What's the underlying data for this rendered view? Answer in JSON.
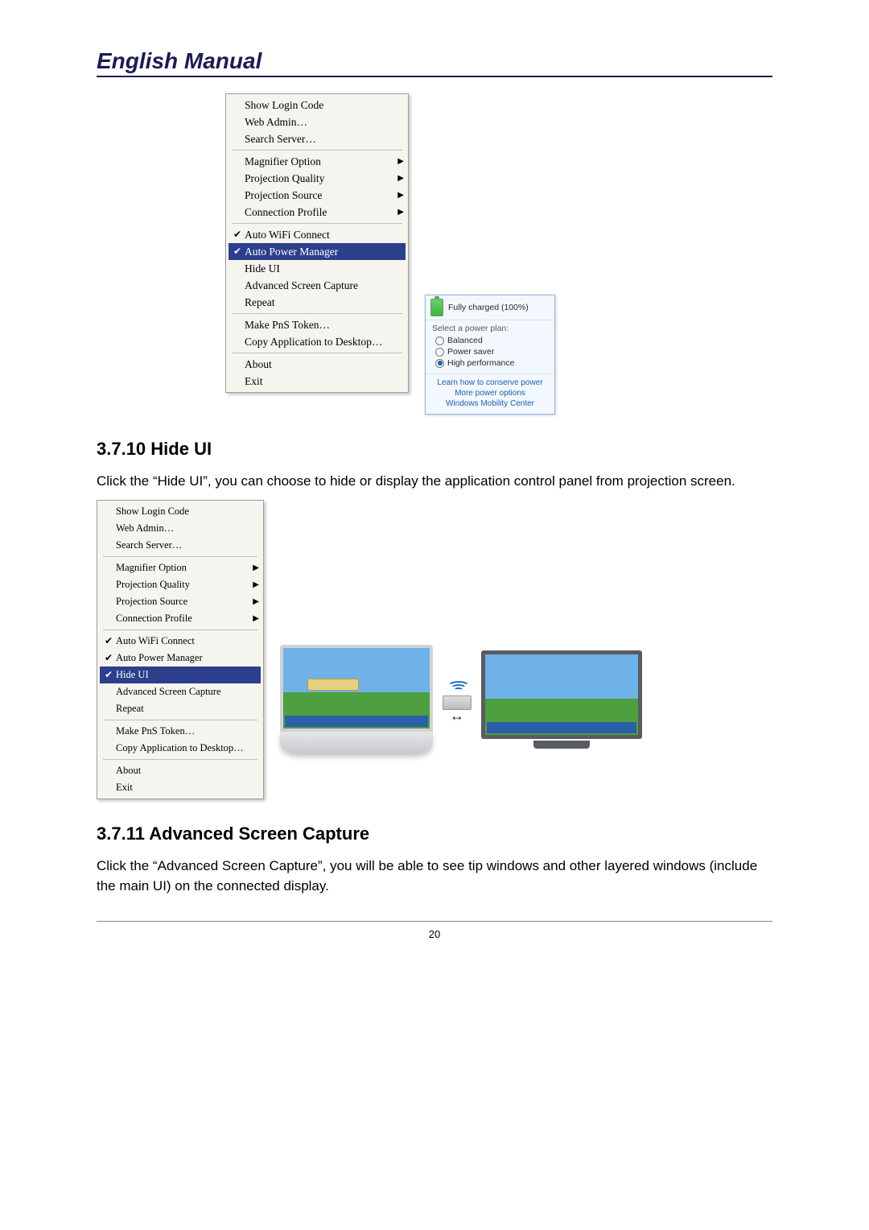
{
  "header": {
    "title": "English Manual"
  },
  "menu1": {
    "group1": [
      "Show Login Code",
      "Web Admin…",
      "Search Server…"
    ],
    "group2": [
      "Magnifier Option",
      "Projection Quality",
      "Projection Source",
      "Connection Profile"
    ],
    "group3": [
      {
        "label": "Auto WiFi Connect",
        "checked": true,
        "highlight": false
      },
      {
        "label": "Auto Power Manager",
        "checked": true,
        "highlight": true
      },
      {
        "label": "Hide UI",
        "checked": false,
        "highlight": false
      },
      {
        "label": "Advanced Screen Capture",
        "checked": false,
        "highlight": false
      },
      {
        "label": "Repeat",
        "checked": false,
        "highlight": false
      }
    ],
    "group4": [
      "Make PnS Token…",
      "Copy Application to Desktop…"
    ],
    "group5": [
      "About",
      "Exit"
    ]
  },
  "power": {
    "status": "Fully charged (100%)",
    "select_label": "Select a power plan:",
    "plans": [
      {
        "label": "Balanced",
        "selected": false
      },
      {
        "label": "Power saver",
        "selected": false
      },
      {
        "label": "High performance",
        "selected": true
      }
    ],
    "links": [
      "Learn how to conserve power",
      "More power options",
      "Windows Mobility Center"
    ]
  },
  "section1": {
    "heading": "3.7.10 Hide UI",
    "text": "Click the “Hide UI”, you can choose to hide or display the application control panel from projection screen."
  },
  "menu2": {
    "group1": [
      "Show Login Code",
      "Web Admin…",
      "Search Server…"
    ],
    "group2": [
      "Magnifier Option",
      "Projection Quality",
      "Projection Source",
      "Connection Profile"
    ],
    "group3": [
      {
        "label": "Auto WiFi Connect",
        "checked": true,
        "highlight": false
      },
      {
        "label": "Auto Power Manager",
        "checked": true,
        "highlight": false
      },
      {
        "label": "Hide UI",
        "checked": true,
        "highlight": true
      },
      {
        "label": "Advanced Screen Capture",
        "checked": false,
        "highlight": false
      },
      {
        "label": "Repeat",
        "checked": false,
        "highlight": false
      }
    ],
    "group4": [
      "Make PnS Token…",
      "Copy Application to Desktop…"
    ],
    "group5": [
      "About",
      "Exit"
    ]
  },
  "section2": {
    "heading": "3.7.11 Advanced Screen Capture",
    "text": "Click the “Advanced Screen Capture”, you will be able to see tip windows and other layered windows (include the main UI) on the connected display."
  },
  "page_number": "20"
}
